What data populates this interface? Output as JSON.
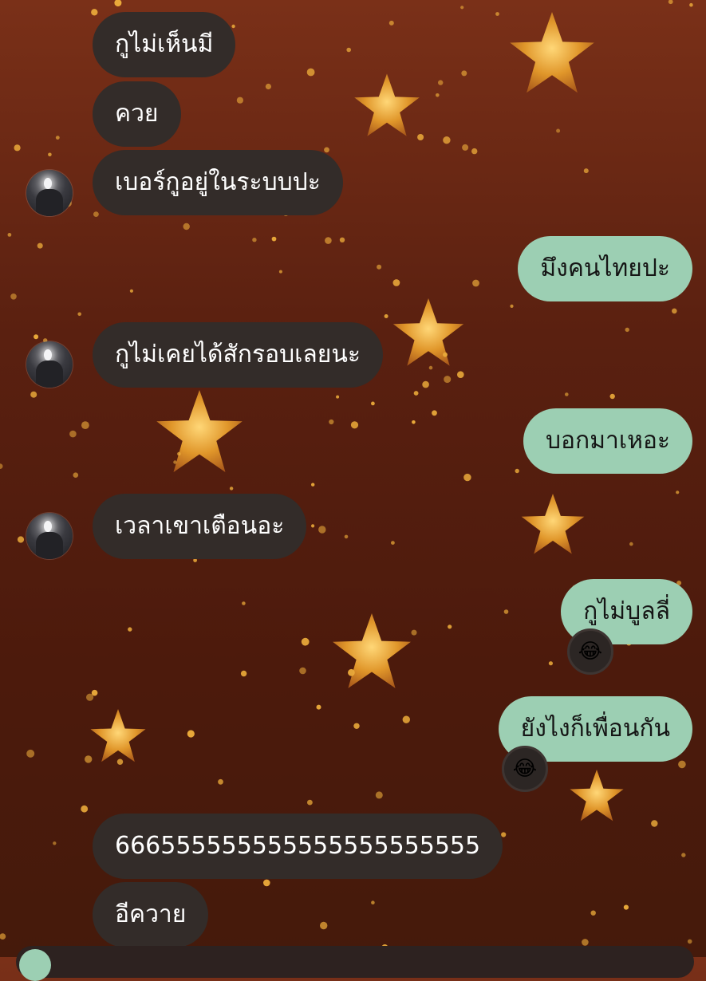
{
  "messages": [
    {
      "text": "กูไม่เห็นมี",
      "side": "in"
    },
    {
      "text": "ควย",
      "side": "in"
    },
    {
      "text": "เบอร์กูอยู่ในระบบปะ",
      "side": "in"
    },
    {
      "text": "มึงคนไทยปะ",
      "side": "out"
    },
    {
      "text": "กูไม่เคยได้สักรอบเลยนะ",
      "side": "in"
    },
    {
      "text": "บอกมาเหอะ",
      "side": "out"
    },
    {
      "text": "เวลาเขาเตือนอะ",
      "side": "in"
    },
    {
      "text": "กูไม่บูลลี่",
      "side": "out",
      "reaction": "😂"
    },
    {
      "text": "ยังไงก็เพื่อนกัน",
      "side": "out",
      "reaction": "😂"
    },
    {
      "text": "666555555555555555555555",
      "side": "in"
    },
    {
      "text": "อีควาย",
      "side": "in"
    }
  ],
  "colors": {
    "incoming_bubble": "#332c29",
    "outgoing_bubble": "#9ccfb3",
    "incoming_text": "#ffffff",
    "outgoing_text": "#151515",
    "background_top": "#7a3018",
    "background_bottom": "#451a0b",
    "glitter": "#e9a93a"
  },
  "background": {
    "theme": "gold glitter stars",
    "decorations": [
      "star-icon",
      "glitter-dot"
    ]
  },
  "icons": {
    "avatar": "contact-avatar",
    "reaction": "face-with-tears-of-joy-icon"
  }
}
